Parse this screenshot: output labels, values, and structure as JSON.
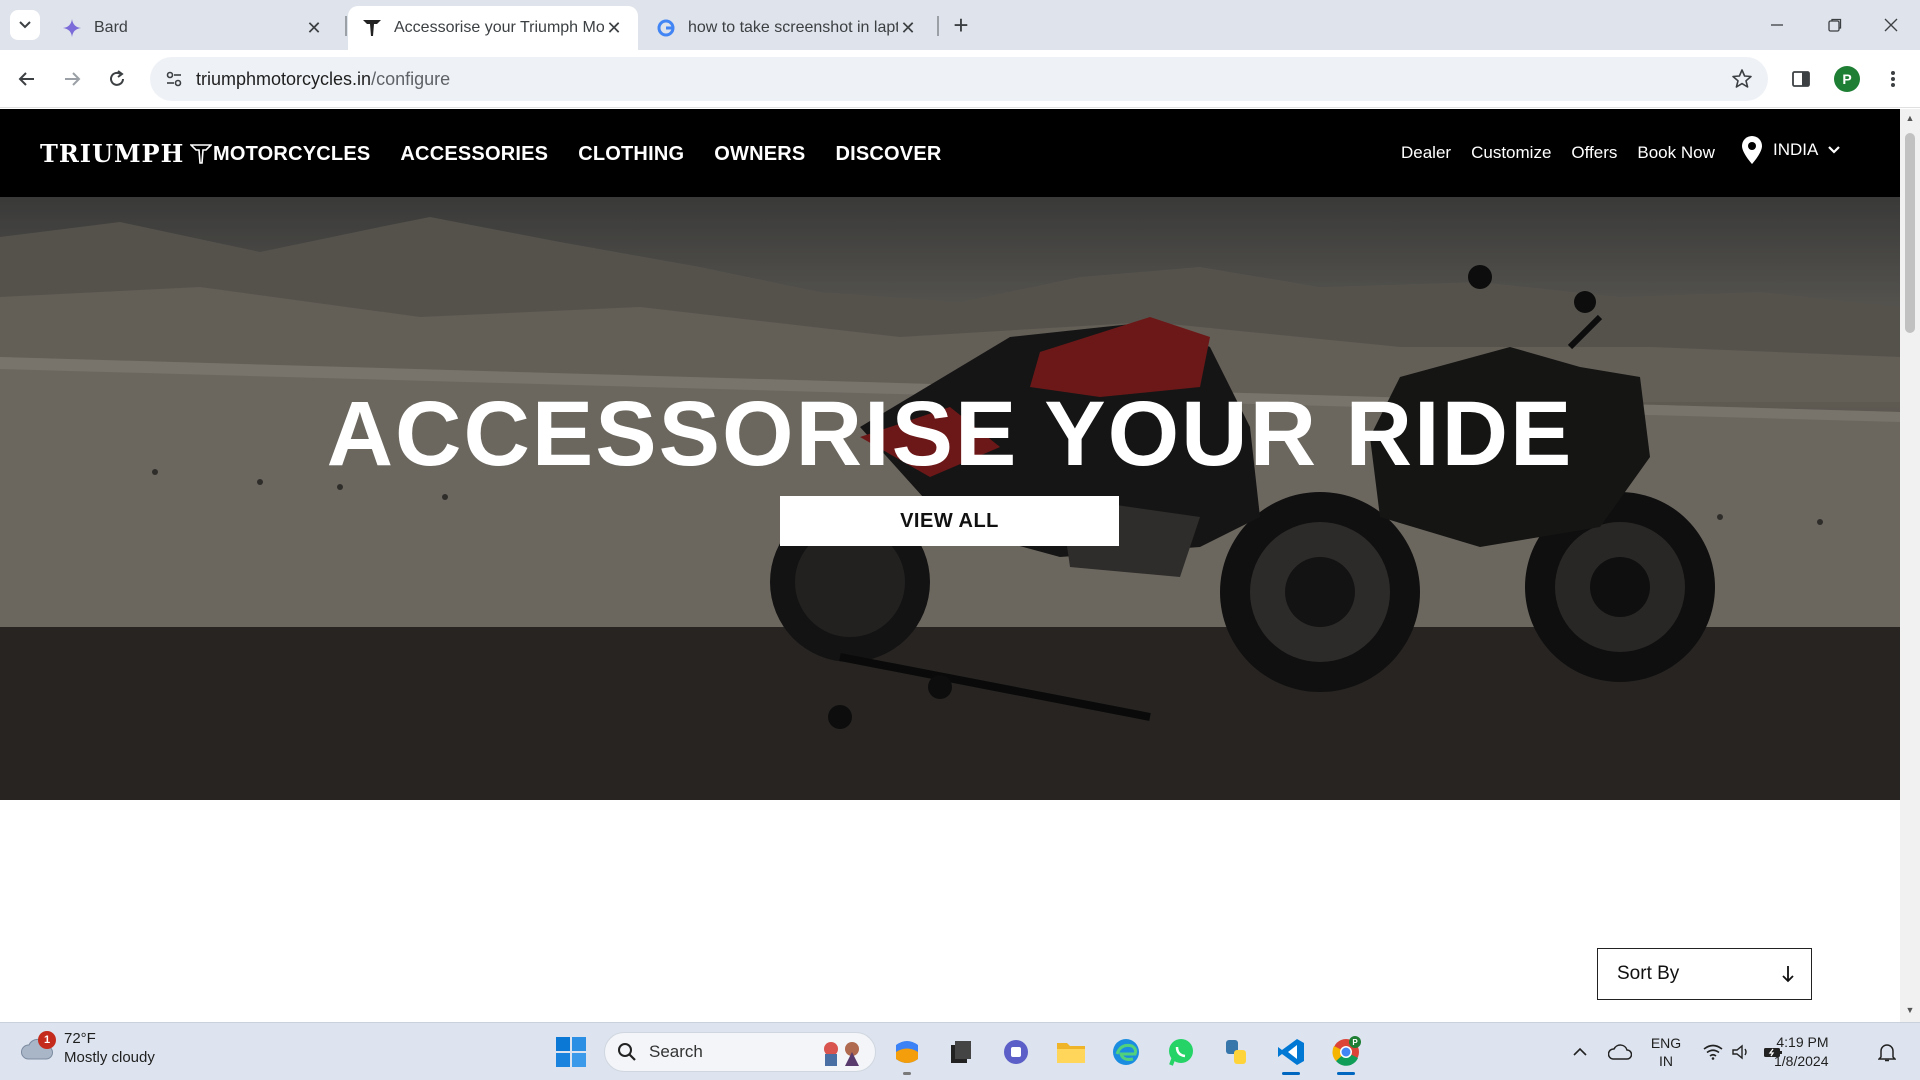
{
  "browser": {
    "tabs": [
      {
        "title": "Bard",
        "favicon": "bard-sparkle-icon",
        "active": false
      },
      {
        "title": "Accessorise your Triumph Moto",
        "favicon": "triumph-logo-icon",
        "active": true
      },
      {
        "title": "how to take screenshot in lapto",
        "favicon": "google-g-icon",
        "active": false
      }
    ],
    "url_host": "triumphmotorcycles.in",
    "url_path": "/configure",
    "profile_initial": "P"
  },
  "site": {
    "logo_text": "TRIUMPH",
    "main_nav": [
      "MOTORCYCLES",
      "ACCESSORIES",
      "CLOTHING",
      "OWNERS",
      "DISCOVER"
    ],
    "utility_nav": [
      "Dealer",
      "Customize",
      "Offers",
      "Book Now"
    ],
    "region": "INDIA"
  },
  "hero": {
    "title": "ACCESSORISE YOUR RIDE",
    "cta": "VIEW ALL"
  },
  "sort": {
    "label": "Sort By"
  },
  "taskbar": {
    "weather": {
      "temp": "72°F",
      "condition": "Mostly cloudy",
      "badge": "1"
    },
    "search_label": "Search",
    "apps": [
      "copilot-icon",
      "file-manager-icon",
      "teams-icon",
      "file-explorer-icon",
      "edge-icon",
      "whatsapp-icon",
      "python-icon",
      "vscode-icon",
      "chrome-icon"
    ],
    "language_line1": "ENG",
    "language_line2": "IN",
    "time": "4:19 PM",
    "date": "1/8/2024"
  },
  "colors": {
    "site_header_bg": "#000000",
    "taskbar_bg": "#dde4ef",
    "tab_strip_bg": "#dfe3eb"
  }
}
